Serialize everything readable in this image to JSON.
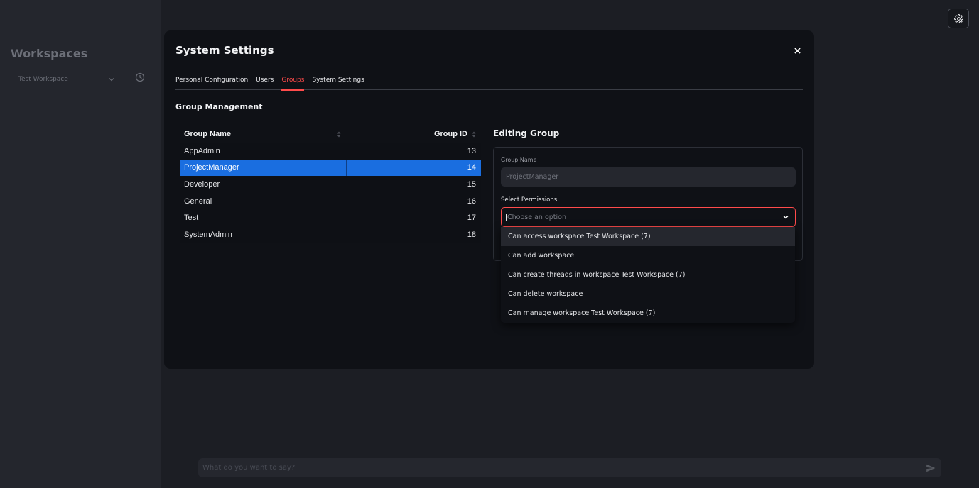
{
  "sidebar": {
    "title": "Workspaces",
    "workspace_selected": "Test Workspace"
  },
  "chat": {
    "placeholder": "What do you want to say?"
  },
  "modal": {
    "title": "System Settings",
    "tabs": [
      {
        "label": "Personal Configuration",
        "active": false
      },
      {
        "label": "Users",
        "active": false
      },
      {
        "label": "Groups",
        "active": true
      },
      {
        "label": "System Settings",
        "active": false
      }
    ],
    "section_title": "Group Management",
    "table": {
      "headers": {
        "name": "Group Name",
        "id": "Group ID"
      },
      "rows": [
        {
          "name": "AppAdmin",
          "id": "13"
        },
        {
          "name": "ProjectManager",
          "id": "14"
        },
        {
          "name": "Developer",
          "id": "15"
        },
        {
          "name": "General",
          "id": "16"
        },
        {
          "name": "Test",
          "id": "17"
        },
        {
          "name": "SystemAdmin",
          "id": "18"
        }
      ],
      "selected_row": "ProjectManager"
    },
    "editing": {
      "title": "Editing Group",
      "name_label": "Group Name",
      "name_value": "ProjectManager",
      "perm_label": "Select Permissions",
      "perm_placeholder": "Choose an option",
      "options": [
        "Can access workspace Test Workspace (7)",
        "Can add workspace",
        "Can create threads in workspace Test Workspace (7)",
        "Can delete workspace",
        "Can manage workspace Test Workspace (7)"
      ]
    }
  },
  "colors": {
    "accent": "#ff4b4b",
    "selection": "#1a6ee0",
    "modal_bg": "#0f1116",
    "page_bg": "#1c1e24",
    "sidebar_bg": "#24262d"
  }
}
